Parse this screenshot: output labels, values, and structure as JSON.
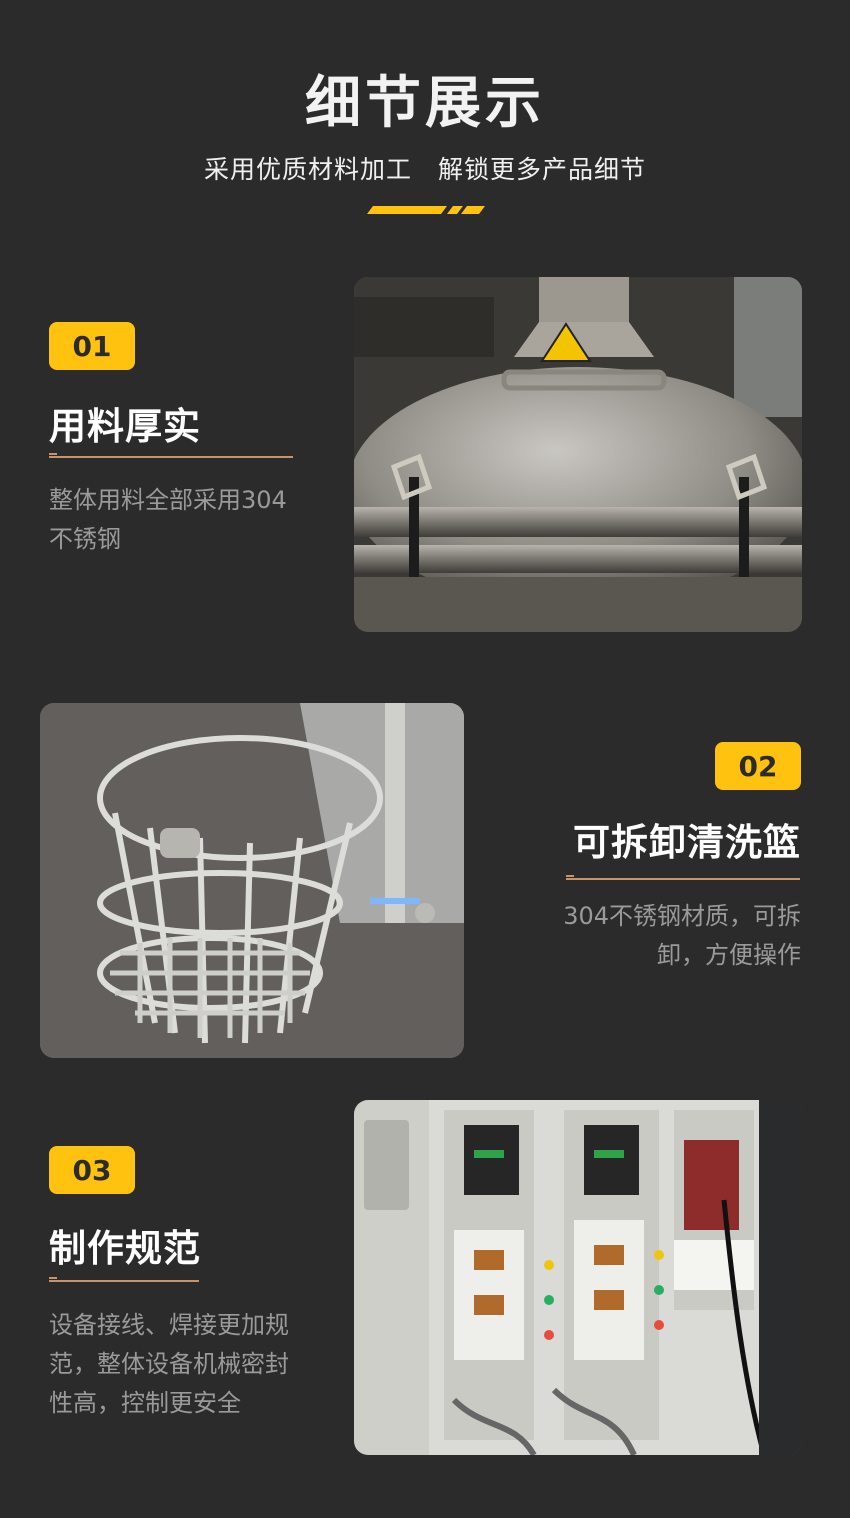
{
  "header": {
    "title": "细节展示",
    "subtitle": "采用优质材料加工　解锁更多产品细节"
  },
  "colors": {
    "background": "#2b2b2b",
    "accent": "#ffc20e",
    "divider": "#c9936a",
    "desc_text": "#9a9a9a"
  },
  "sections": [
    {
      "number": "01",
      "heading": "用料厚实",
      "desc_line1": "整体用料全部采用304",
      "desc_line2": "不锈钢",
      "image": "stainless-steel-tank-lid"
    },
    {
      "number": "02",
      "heading": "可拆卸清洗篮",
      "desc_line1": "304不锈钢材质，可拆",
      "desc_line2": "卸，方便操作",
      "image": "stainless-steel-basket"
    },
    {
      "number": "03",
      "heading": "制作规范",
      "desc_line1": "设备接线、焊接更加规",
      "desc_line2": "范，整体设备机械密封",
      "desc_line3": "性高，控制更安全",
      "image": "electrical-control-cabinet"
    }
  ]
}
